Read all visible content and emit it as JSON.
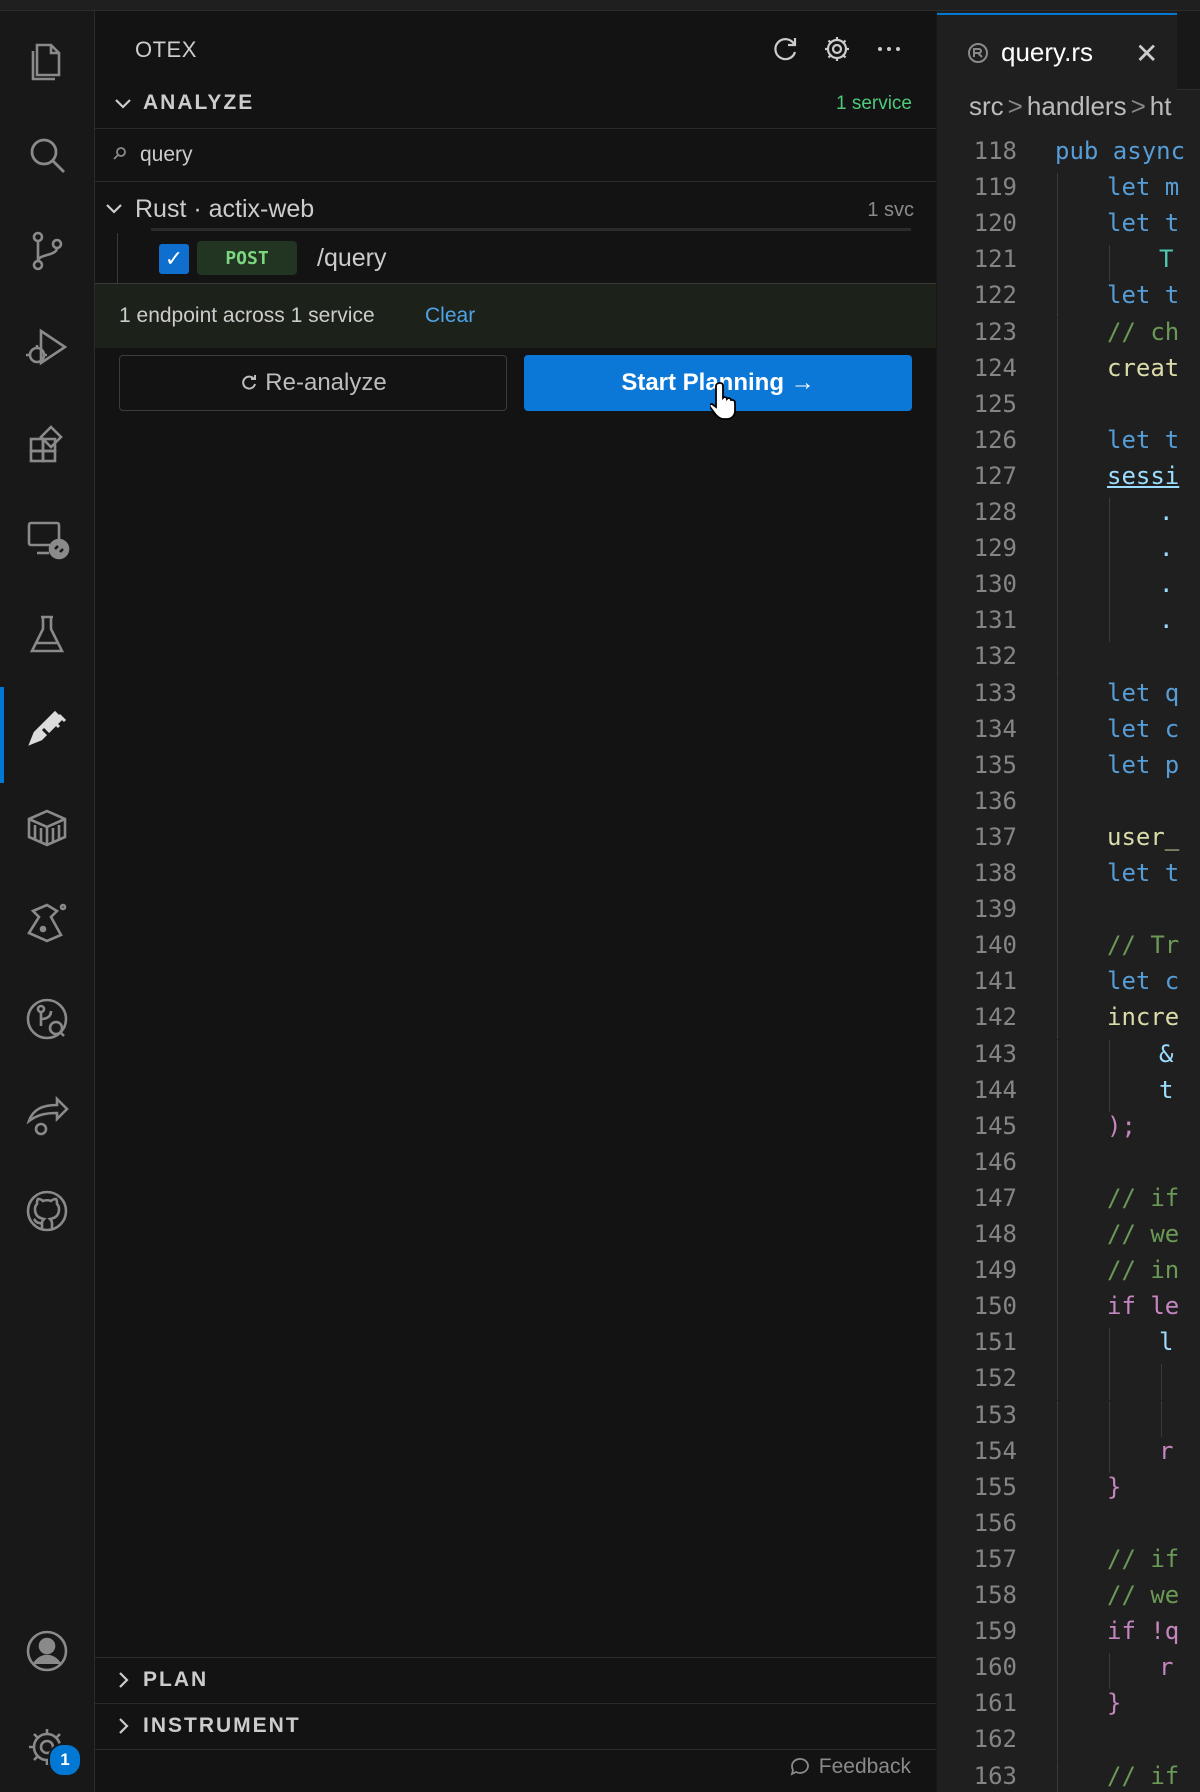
{
  "sidebar": {
    "title": "OTEX",
    "analyze": {
      "label": "ANALYZE",
      "count": "1 service",
      "search_value": "query",
      "group": {
        "label": "Rust · actix-web",
        "count": "1 svc"
      },
      "endpoint": {
        "method": "POST",
        "path": "/query",
        "checked": true
      },
      "summary": "1 endpoint across 1 service",
      "clear_label": "Clear",
      "reanalyze_label": "Re-analyze",
      "start_label": "Start Planning →"
    },
    "plan_label": "PLAN",
    "instrument_label": "INSTRUMENT",
    "feedback_label": "Feedback"
  },
  "activity_bar": {
    "icons": [
      "files-icon",
      "search-icon",
      "source-control-icon",
      "run-debug-icon",
      "extensions-icon",
      "remote-explorer-icon",
      "testing-icon",
      "otex-icon",
      "package-icon",
      "flask-icon",
      "git-graph-icon",
      "share-icon",
      "github-icon"
    ],
    "active": "otex-icon",
    "settings_badge": "1"
  },
  "editor": {
    "tab_name": "query.rs",
    "breadcrumb": [
      "src",
      "handlers",
      "ht"
    ],
    "partial_top_line": "117",
    "lines": [
      {
        "n": "118",
        "text": "pub async",
        "indent": 0
      },
      {
        "n": "119",
        "text": "let m",
        "indent": 1
      },
      {
        "n": "120",
        "text": "let t",
        "indent": 1
      },
      {
        "n": "121",
        "text": "T",
        "indent": 2
      },
      {
        "n": "122",
        "text": "let t",
        "indent": 1
      },
      {
        "n": "123",
        "text": "// ch",
        "indent": 1
      },
      {
        "n": "124",
        "text": "creat",
        "indent": 1
      },
      {
        "n": "125",
        "text": "",
        "indent": 1
      },
      {
        "n": "126",
        "text": "let t",
        "indent": 1
      },
      {
        "n": "127",
        "text": "sessi",
        "indent": 1
      },
      {
        "n": "128",
        "text": ".",
        "indent": 2
      },
      {
        "n": "129",
        "text": ".",
        "indent": 2
      },
      {
        "n": "130",
        "text": ".",
        "indent": 2
      },
      {
        "n": "131",
        "text": ".",
        "indent": 2
      },
      {
        "n": "132",
        "text": "",
        "indent": 1
      },
      {
        "n": "133",
        "text": "let q",
        "indent": 1
      },
      {
        "n": "134",
        "text": "let c",
        "indent": 1
      },
      {
        "n": "135",
        "text": "let p",
        "indent": 1
      },
      {
        "n": "136",
        "text": "",
        "indent": 1
      },
      {
        "n": "137",
        "text": "user_",
        "indent": 1
      },
      {
        "n": "138",
        "text": "let t",
        "indent": 1
      },
      {
        "n": "139",
        "text": "",
        "indent": 1
      },
      {
        "n": "140",
        "text": "// Tr",
        "indent": 1
      },
      {
        "n": "141",
        "text": "let c",
        "indent": 1
      },
      {
        "n": "142",
        "text": "incre",
        "indent": 1
      },
      {
        "n": "143",
        "text": "&",
        "indent": 2
      },
      {
        "n": "144",
        "text": "t",
        "indent": 2
      },
      {
        "n": "145",
        "text": ");",
        "indent": 1
      },
      {
        "n": "146",
        "text": "",
        "indent": 1
      },
      {
        "n": "147",
        "text": "// if",
        "indent": 1
      },
      {
        "n": "148",
        "text": "// we",
        "indent": 1
      },
      {
        "n": "149",
        "text": "// in",
        "indent": 1
      },
      {
        "n": "150",
        "text": "if le",
        "indent": 1
      },
      {
        "n": "151",
        "text": "l",
        "indent": 2
      },
      {
        "n": "152",
        "text": "",
        "indent": 3
      },
      {
        "n": "153",
        "text": "",
        "indent": 3
      },
      {
        "n": "154",
        "text": "r",
        "indent": 2
      },
      {
        "n": "155",
        "text": "}",
        "indent": 1
      },
      {
        "n": "156",
        "text": "",
        "indent": 1
      },
      {
        "n": "157",
        "text": "// if",
        "indent": 1
      },
      {
        "n": "158",
        "text": "// we",
        "indent": 1
      },
      {
        "n": "159",
        "text": "if !q",
        "indent": 1
      },
      {
        "n": "160",
        "text": "r",
        "indent": 2
      },
      {
        "n": "161",
        "text": "}",
        "indent": 1
      },
      {
        "n": "162",
        "text": "",
        "indent": 1
      },
      {
        "n": "163",
        "text": "// if",
        "indent": 1
      }
    ],
    "colors": {
      "keyword": "#569cd6",
      "control": "#c586c0",
      "comment": "#6a9955",
      "function": "#dcdcaa",
      "type": "#4ec9b0",
      "variable": "#9cdcfe",
      "punct": "#cccccc"
    }
  }
}
